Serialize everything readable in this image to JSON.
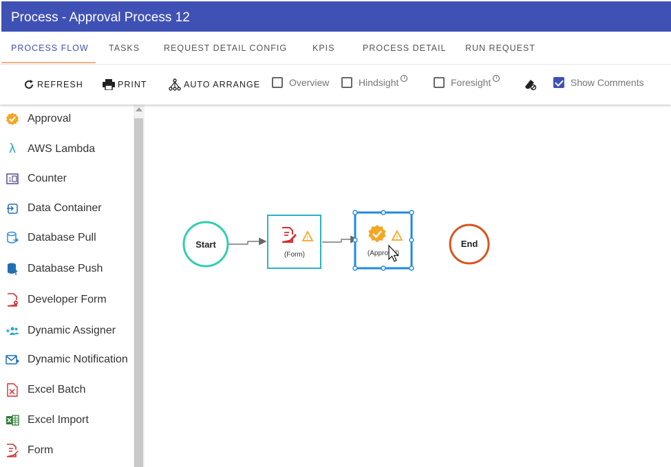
{
  "window": {
    "title": "Process - Approval Process 12"
  },
  "tabs": [
    {
      "label": "PROCESS FLOW"
    },
    {
      "label": "TASKS"
    },
    {
      "label": "REQUEST DETAIL CONFIG"
    },
    {
      "label": "KPIS"
    },
    {
      "label": "PROCESS DETAIL"
    },
    {
      "label": "RUN REQUEST"
    }
  ],
  "active_tab": "PROCESS FLOW",
  "toolbar": {
    "refresh_label": "REFRESH",
    "print_label": "PRINT",
    "auto_arrange_label": "AUTO ARRANGE",
    "overview_label": "Overview",
    "overview_checked": false,
    "hindsight_label": "Hindsight",
    "hindsight_checked": false,
    "foresight_label": "Foresight",
    "foresight_checked": false,
    "show_comments_label": "Show Comments",
    "show_comments_checked": true,
    "info_glyph": "i",
    "eraser_icon": "eraser-icon"
  },
  "sidebar": {
    "items": [
      {
        "label": "Approval",
        "icon": "approval-badge-icon"
      },
      {
        "label": "AWS Lambda",
        "icon": "lambda-icon"
      },
      {
        "label": "Counter",
        "icon": "counter-icon"
      },
      {
        "label": "Data Container",
        "icon": "data-container-icon"
      },
      {
        "label": "Database Pull",
        "icon": "database-pull-icon"
      },
      {
        "label": "Database Push",
        "icon": "database-push-icon"
      },
      {
        "label": "Developer Form",
        "icon": "developer-form-icon"
      },
      {
        "label": "Dynamic Assigner",
        "icon": "dynamic-assigner-icon"
      },
      {
        "label": "Dynamic Notification",
        "icon": "dynamic-notification-icon"
      },
      {
        "label": "Excel Batch",
        "icon": "excel-batch-icon"
      },
      {
        "label": "Excel Import",
        "icon": "excel-import-icon"
      },
      {
        "label": "Form",
        "icon": "form-icon"
      }
    ]
  },
  "flow": {
    "start_label": "Start",
    "form_label": "(Form)",
    "approval_label": "(Approval)",
    "end_label": "End",
    "warning_glyph": "!"
  },
  "colors": {
    "header": "#3f51b5",
    "start_ring": "#2ecfb0",
    "end_ring": "#d9531e",
    "form_border": "#27b3c7",
    "selected_border": "#1e88e5",
    "warning": "#f5a623",
    "approval_badge": "#f5a623"
  }
}
